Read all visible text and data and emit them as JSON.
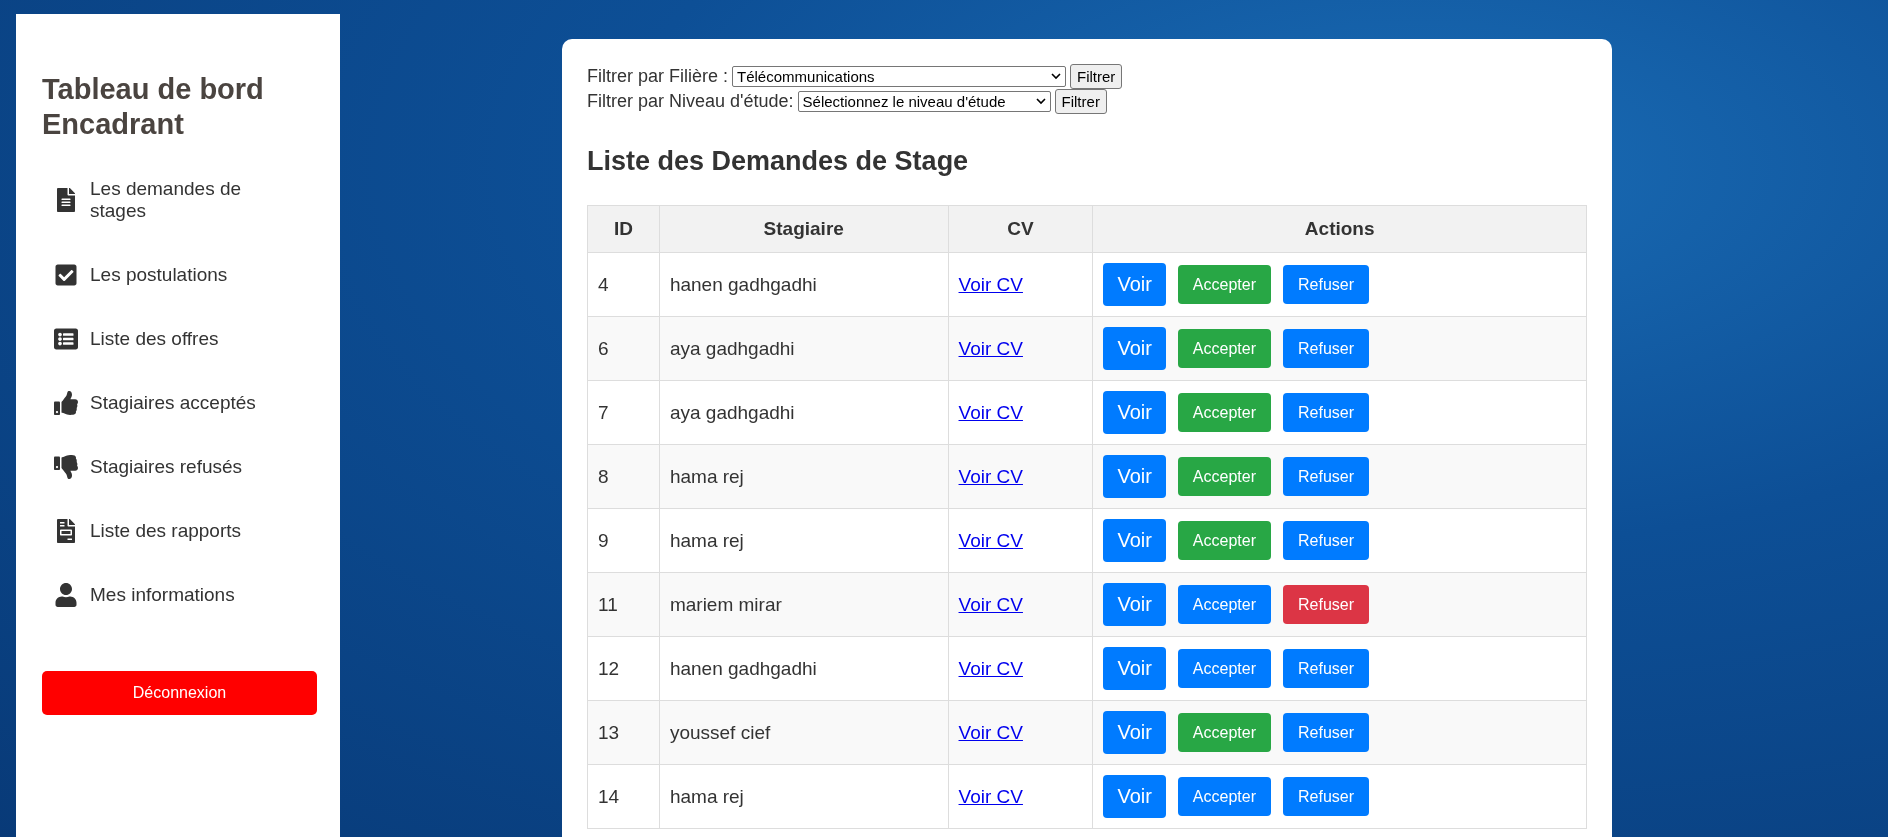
{
  "sidebar": {
    "title": "Tableau de bord Encadrant",
    "items": [
      {
        "label": "Les demandes de stages"
      },
      {
        "label": "Les postulations"
      },
      {
        "label": "Liste des offres"
      },
      {
        "label": "Stagiaires acceptés"
      },
      {
        "label": "Stagiaires refusés"
      },
      {
        "label": "Liste des rapports"
      },
      {
        "label": "Mes informations"
      }
    ],
    "logout": "Déconnexion"
  },
  "filters": [
    {
      "label": "Filtrer par Filière :",
      "value": "Télécommunications",
      "button": "Filtrer"
    },
    {
      "label": "Filtrer par Niveau d'étude:",
      "value": "Sélectionnez le niveau d'étude",
      "button": "Filtrer"
    }
  ],
  "heading": "Liste des Demandes de Stage",
  "table": {
    "columns": [
      "ID",
      "Stagiaire",
      "CV",
      "Actions"
    ],
    "rows": [
      {
        "id": "4",
        "name": "hanen gadhgadhi",
        "cv": "Voir CV",
        "view": "Voir",
        "accept": "Accepter",
        "refuse": "Refuser",
        "accepted": true,
        "refused": false
      },
      {
        "id": "6",
        "name": "aya gadhgadhi",
        "cv": "Voir CV",
        "view": "Voir",
        "accept": "Accepter",
        "refuse": "Refuser",
        "accepted": true,
        "refused": false
      },
      {
        "id": "7",
        "name": "aya gadhgadhi",
        "cv": "Voir CV",
        "view": "Voir",
        "accept": "Accepter",
        "refuse": "Refuser",
        "accepted": true,
        "refused": false
      },
      {
        "id": "8",
        "name": "hama rej",
        "cv": "Voir CV",
        "view": "Voir",
        "accept": "Accepter",
        "refuse": "Refuser",
        "accepted": true,
        "refused": false
      },
      {
        "id": "9",
        "name": "hama rej",
        "cv": "Voir CV",
        "view": "Voir",
        "accept": "Accepter",
        "refuse": "Refuser",
        "accepted": true,
        "refused": false
      },
      {
        "id": "11",
        "name": "mariem mirar",
        "cv": "Voir CV",
        "view": "Voir",
        "accept": "Accepter",
        "refuse": "Refuser",
        "accepted": false,
        "refused": true
      },
      {
        "id": "12",
        "name": "hanen gadhgadhi",
        "cv": "Voir CV",
        "view": "Voir",
        "accept": "Accepter",
        "refuse": "Refuser",
        "accepted": false,
        "refused": false
      },
      {
        "id": "13",
        "name": "youssef cief",
        "cv": "Voir CV",
        "view": "Voir",
        "accept": "Accepter",
        "refuse": "Refuser",
        "accepted": true,
        "refused": false
      },
      {
        "id": "14",
        "name": "hama rej",
        "cv": "Voir CV",
        "view": "Voir",
        "accept": "Accepter",
        "refuse": "Refuser",
        "accepted": false,
        "refused": false
      }
    ]
  }
}
